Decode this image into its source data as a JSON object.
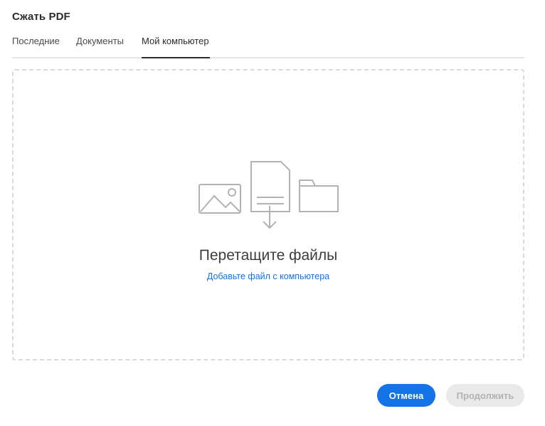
{
  "dialog": {
    "title": "Сжать PDF"
  },
  "tabs": [
    {
      "label": "Последние",
      "active": false
    },
    {
      "label": "Документы",
      "active": false
    },
    {
      "label": "Мой компьютер",
      "active": true
    }
  ],
  "dropzone": {
    "title": "Перетащите файлы",
    "link": "Добавьте файл с компьютера",
    "icons": [
      "image-icon",
      "file-upload-icon",
      "folder-icon"
    ]
  },
  "buttons": {
    "cancel": "Отмена",
    "continue": "Продолжить"
  },
  "colors": {
    "accent": "#1473e6",
    "disabled_bg": "#e9e9e9",
    "disabled_text": "#b3b3b3"
  }
}
